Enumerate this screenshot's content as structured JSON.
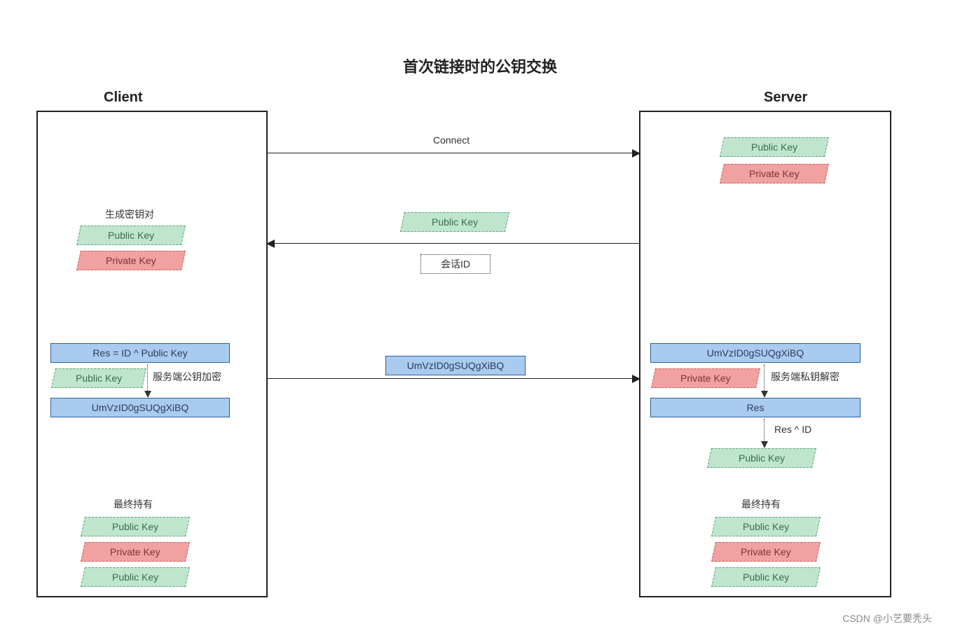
{
  "title": "首次链接时的公钥交换",
  "client": {
    "label": "Client"
  },
  "server": {
    "label": "Server"
  },
  "labels": {
    "connect": "Connect",
    "genKeypair": "生成密钥对",
    "publicKey": "Public Key",
    "privateKey": "Private Key",
    "sessionId": "会话ID",
    "resFormula": "Res = ID ^ Public Key",
    "cipher": "UmVzID0gSUQgXiBQ",
    "encryptNote": "服务端公钥加密",
    "decryptNote": "服务端私钥解密",
    "res": "Res",
    "resXorId": "Res ^ ID",
    "finalHolds": "最终持有"
  },
  "watermark": "CSDN @小艺要秃头"
}
